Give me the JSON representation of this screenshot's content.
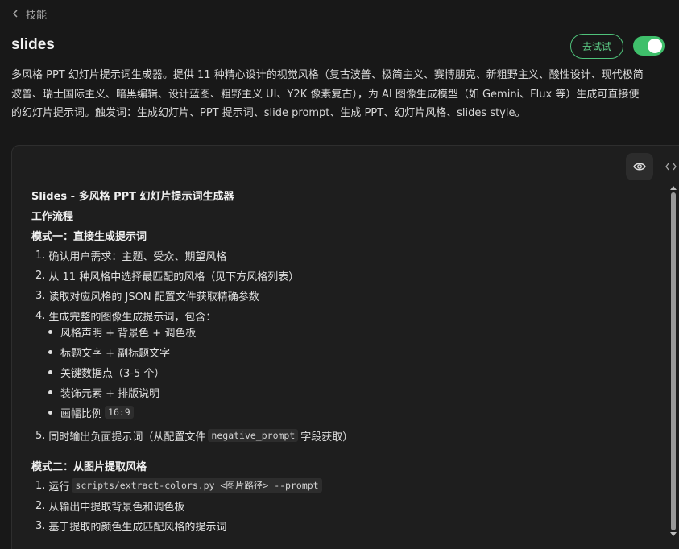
{
  "nav": {
    "back_label": "技能"
  },
  "header": {
    "title": "slides",
    "try_label": "去试试",
    "enabled": true,
    "accent_color": "#3fbf6b"
  },
  "description": {
    "line1": "多风格 PPT 幻灯片提示词生成器。提供 11 种精心设计的视觉风格（复古波普、极简主义、赛博朋克、新粗野主义、酸性设计、现代极简",
    "line2": "波普、瑞士国际主义、暗黑编辑、设计蓝图、粗野主义 UI、Y2K 像素复古），为 AI 图像生成模型（如 Gemini、Flux 等）生成可直接使",
    "line3": "的幻灯片提示词。触发词：生成幻灯片、PPT 提示词、slide prompt、生成 PPT、幻灯片风格、slides style。"
  },
  "doc": {
    "heading": "Slides - 多风格 PPT 幻灯片提示词生成器",
    "workflow_heading": "工作流程",
    "mode1_heading": "模式一：直接生成提示词",
    "mode1_steps": [
      {
        "num": "1.",
        "text": "确认用户需求：主题、受众、期望风格"
      },
      {
        "num": "2.",
        "text": "从 11 种风格中选择最匹配的风格（见下方风格列表）"
      },
      {
        "num": "3.",
        "text": "读取对应风格的 JSON 配置文件获取精确参数"
      },
      {
        "num": "4.",
        "text": "生成完整的图像生成提示词，包含："
      }
    ],
    "mode1_bullets": [
      "风格声明 + 背景色 + 调色板",
      "标题文字 + 副标题文字",
      "关键数据点（3-5 个）",
      "装饰元素 + 排版说明"
    ],
    "ratio_label": "画幅比例",
    "ratio_code": "16:9",
    "step5": {
      "num": "5.",
      "before": "同时输出负面提示词（从配置文件",
      "code": "negative_prompt",
      "after": "字段获取）"
    },
    "mode2_heading": "模式二：从图片提取风格",
    "mode2_step1": {
      "num": "1.",
      "before": "运行",
      "code": "scripts/extract-colors.py <图片路径> --prompt"
    },
    "mode2_step2": {
      "num": "2.",
      "text": "从输出中提取背景色和调色板"
    },
    "mode2_step3": {
      "num": "3.",
      "text": "基于提取的颜色生成匹配风格的提示词"
    }
  },
  "icons": {
    "back": "chevron-left-icon",
    "preview": "eye-icon",
    "source": "code-icon"
  }
}
